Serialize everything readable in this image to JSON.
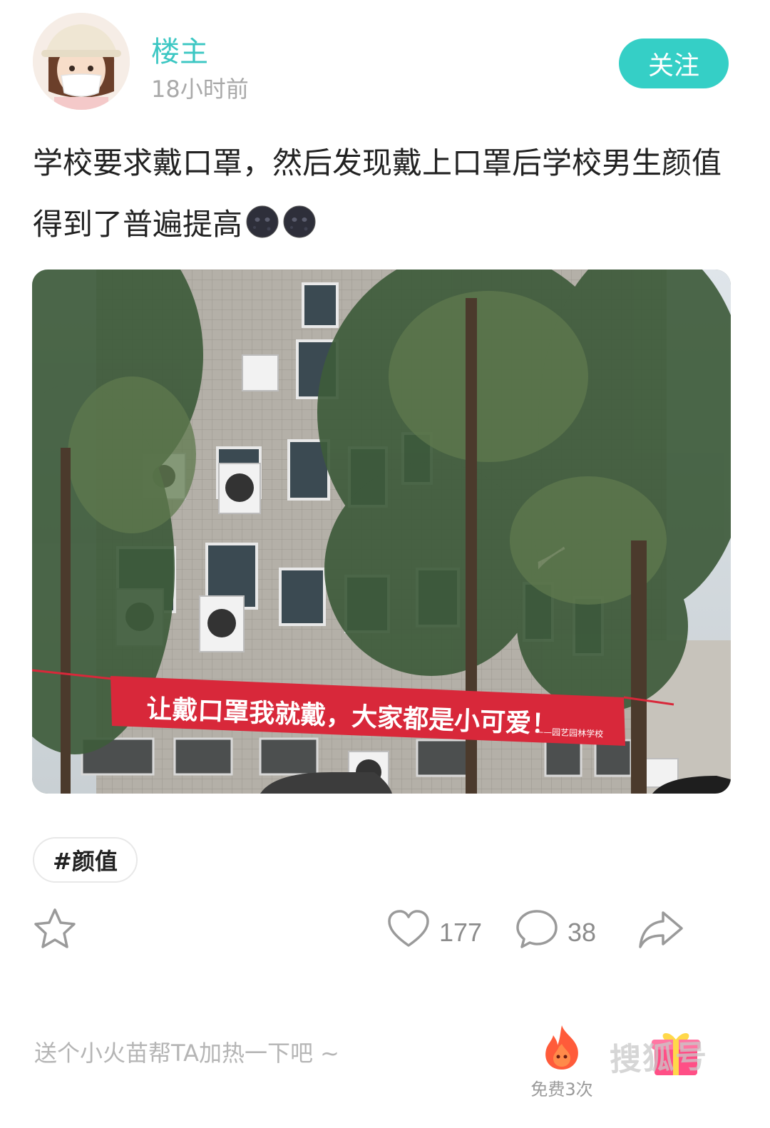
{
  "author": {
    "name": "楼主",
    "time": "18小时前",
    "follow_label": "关注"
  },
  "post": {
    "text": "学校要求戴口罩，然后发现戴上口罩后学校男生颜值得到了普遍提高",
    "emojis": [
      "new-moon-face",
      "new-moon-face"
    ],
    "image": {
      "banner_text": "让戴口罩我就戴，大家都是小可爱！",
      "banner_signature": "——园艺园林学校"
    },
    "tag": "#颜值"
  },
  "actions": {
    "like_count": "177",
    "comment_count": "38"
  },
  "cheer": {
    "prompt": "送个小火苗帮TA加热一下吧 ~",
    "fire_label": "免费3次"
  },
  "watermark": "搜狐号",
  "colors": {
    "accent": "#35cfc6",
    "name": "#3cc7c3",
    "banner": "#d8283a"
  }
}
